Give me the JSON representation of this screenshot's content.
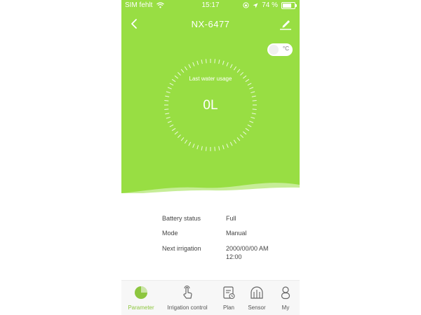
{
  "status_bar": {
    "carrier": "SIM fehlt",
    "time": "15:17",
    "battery_percent": "74 %",
    "battery_level": 0.74
  },
  "header": {
    "title": "NX-6477",
    "back_icon": "chevron-left-icon",
    "edit_icon": "edit-pencil-icon"
  },
  "temp_toggle": {
    "unit": "°C"
  },
  "gauge": {
    "label": "Last water usage",
    "value": "0L"
  },
  "info": [
    {
      "key": "Battery status",
      "value": "Full"
    },
    {
      "key": "Mode",
      "value": "Manual"
    },
    {
      "key": "Next irrigation",
      "value": "2000/00/00 AM 12:00"
    }
  ],
  "tabs": [
    {
      "label": "Parameter",
      "icon": "pie-chart-icon",
      "active": true
    },
    {
      "label": "Irrigation control",
      "icon": "touch-hand-icon",
      "active": false
    },
    {
      "label": "Plan",
      "icon": "plan-list-icon",
      "active": false
    },
    {
      "label": "Sensor",
      "icon": "sensor-icon",
      "active": false
    },
    {
      "label": "My",
      "icon": "user-icon",
      "active": false
    }
  ],
  "colors": {
    "hero": "#98de43",
    "accent": "#8dc63f"
  }
}
